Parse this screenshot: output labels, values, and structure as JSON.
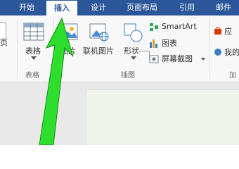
{
  "tabs": [
    {
      "label": "开始"
    },
    {
      "label": "插入"
    },
    {
      "label": "设计"
    },
    {
      "label": "页面布局"
    },
    {
      "label": "引用"
    },
    {
      "label": "邮件"
    }
  ],
  "ribbon": {
    "left_cut_label": "页",
    "table_group": {
      "button_label": "表格",
      "group_label": "表格"
    },
    "illustrations_group": {
      "picture_label": "图片",
      "online_picture_label": "联机图片",
      "shapes_label": "形状",
      "smartart_label": "SmartArt",
      "chart_label": "图表",
      "screenshot_label": "屏幕截图",
      "group_label": "插图"
    },
    "addins_group": {
      "store_label": "应",
      "my_addins_label": "我的",
      "group_label": "加"
    }
  },
  "colors": {
    "title_bar": "#2b579a",
    "ribbon_bg": "#f8f8f8",
    "arrow": "#2dde2d"
  }
}
